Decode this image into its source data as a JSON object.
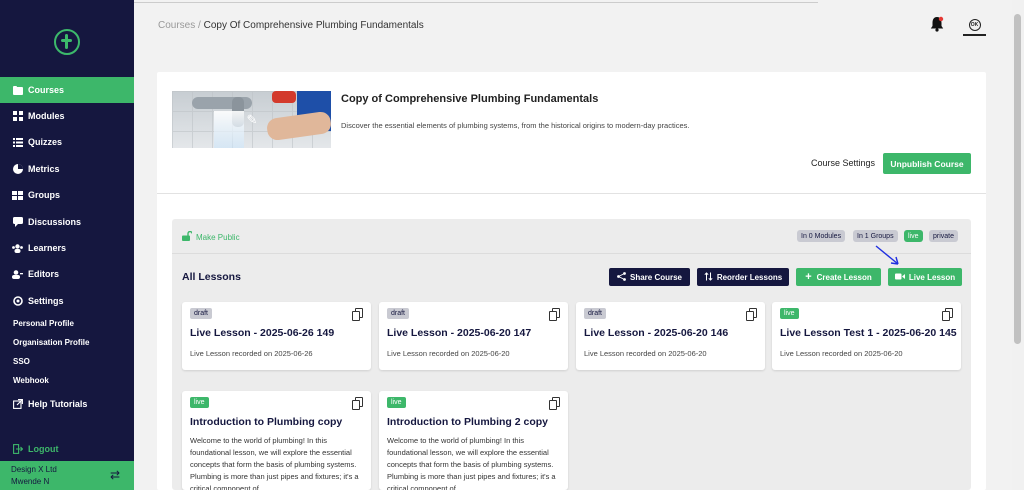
{
  "sidebar": {
    "items": [
      {
        "label": "Courses",
        "icon": "folder-icon"
      },
      {
        "label": "Modules",
        "icon": "grid-icon"
      },
      {
        "label": "Quizzes",
        "icon": "list-icon"
      },
      {
        "label": "Metrics",
        "icon": "pie-chart-icon"
      },
      {
        "label": "Groups",
        "icon": "groups-icon"
      },
      {
        "label": "Discussions",
        "icon": "comment-icon"
      },
      {
        "label": "Learners",
        "icon": "users-icon"
      },
      {
        "label": "Editors",
        "icon": "user-edit-icon"
      },
      {
        "label": "Settings",
        "icon": "gear-icon"
      }
    ],
    "sub_items": [
      "Personal Profile",
      "Organisation Profile",
      "SSO",
      "Webhook"
    ],
    "help": "Help Tutorials",
    "logout": "Logout",
    "account_org": "Design X Ltd",
    "account_user": "Mwende N",
    "accent": "#3db76a",
    "bg": "#15173f"
  },
  "header": {
    "breadcrumb_root": "Courses",
    "breadcrumb_sep": " / ",
    "breadcrumb_current": "Copy Of Comprehensive Plumbing Fundamentals",
    "avatar_initials": "OK"
  },
  "course": {
    "title": "Copy of Comprehensive Plumbing Fundamentals",
    "description": "Discover the essential elements of plumbing systems, from the historical origins to modern-day practices.",
    "settings_label": "Course Settings",
    "unpublish_label": "Unpublish Course"
  },
  "lessons": {
    "make_public": "Make Public",
    "pills": [
      "In 0 Modules",
      "In 1 Groups",
      "live",
      "private"
    ],
    "heading": "All Lessons",
    "share_label": "Share Course",
    "reorder_label": "Reorder Lessons",
    "create_label": "Create Lesson",
    "live_label": "Live Lesson",
    "cards": [
      {
        "status": "draft",
        "title": "Live Lesson - 2025-06-26 149",
        "subtitle": "Live Lesson recorded on 2025-06-26"
      },
      {
        "status": "draft",
        "title": "Live Lesson - 2025-06-20 147",
        "subtitle": "Live Lesson recorded on 2025-06-20"
      },
      {
        "status": "draft",
        "title": "Live Lesson - 2025-06-20 146",
        "subtitle": "Live Lesson recorded on 2025-06-20"
      },
      {
        "status": "live",
        "title": "Live Lesson Test 1 - 2025-06-20 145",
        "subtitle": "Live Lesson recorded on 2025-06-20"
      },
      {
        "status": "live",
        "title": "Introduction to Plumbing copy",
        "subtitle": "Welcome to the world of plumbing! In this foundational lesson, we will explore the essential concepts that form the basis of plumbing systems. Plumbing is more than just pipes and fixtures; it's a critical component of"
      },
      {
        "status": "live",
        "title": "Introduction to Plumbing 2 copy",
        "subtitle": "Welcome to the world of plumbing! In this foundational lesson, we will explore the essential concepts that form the basis of plumbing systems. Plumbing is more than just pipes and fixtures; it's a critical component of"
      }
    ]
  }
}
